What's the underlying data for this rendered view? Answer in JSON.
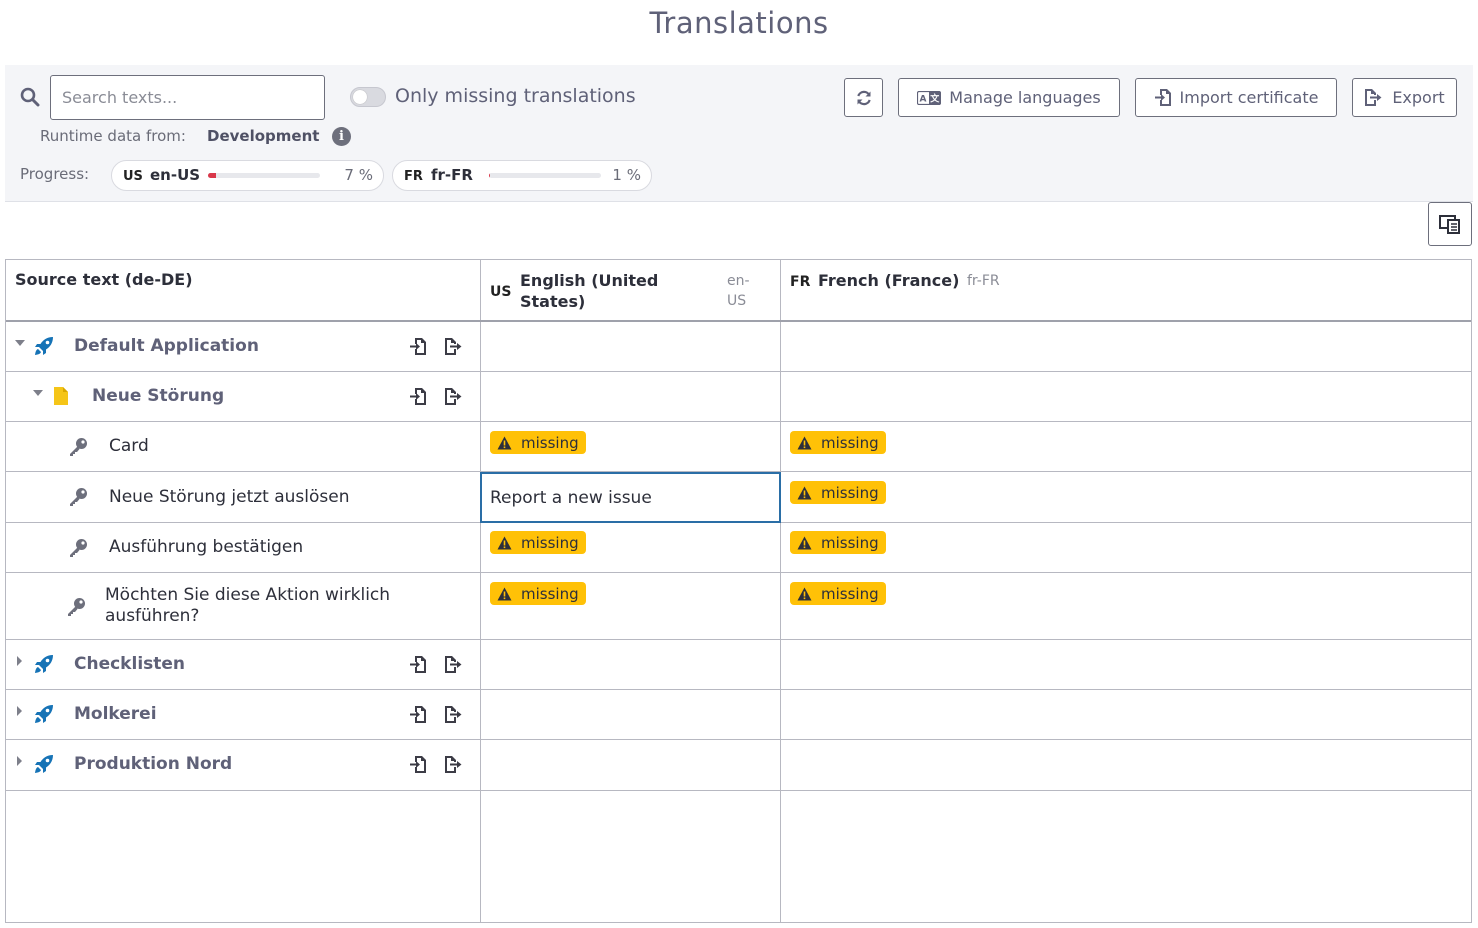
{
  "page_title": "Translations",
  "toolbar": {
    "search_placeholder": "Search texts...",
    "toggle_label": "Only missing translations",
    "refresh_icon": "refresh-icon",
    "manage_languages_label": "Manage languages",
    "import_certificate_label": "Import certificate",
    "export_label": "Export",
    "runtime_label": "Runtime data from:",
    "runtime_value": "Development",
    "progress_label": "Progress:"
  },
  "progress": [
    {
      "flag": "US",
      "code": "en-US",
      "percent_text": "7 %",
      "fraction": 0.07
    },
    {
      "flag": "FR",
      "code": "fr-FR",
      "percent_text": "1 %",
      "fraction": 0.01
    }
  ],
  "table": {
    "source_header": "Source text (de-DE)",
    "languages": [
      {
        "flag": "US",
        "name": "English (United States)",
        "code": "en-US"
      },
      {
        "flag": "FR",
        "name": "French (France)",
        "code": "fr-FR"
      }
    ],
    "missing_label": "missing",
    "rows": [
      {
        "type": "app",
        "label": "Default Application",
        "expanded": true
      },
      {
        "type": "page",
        "label": "Neue Störung",
        "expanded": true
      },
      {
        "type": "key",
        "label": "Card",
        "en": "missing",
        "fr": "missing"
      },
      {
        "type": "key",
        "label": "Neue Störung jetzt auslösen",
        "en": "Report a new issue",
        "fr": "missing"
      },
      {
        "type": "key",
        "label": "Ausführung bestätigen",
        "en": "missing",
        "fr": "missing"
      },
      {
        "type": "key",
        "label": "Möchten Sie diese Aktion wirklich ausführen?",
        "en": "missing",
        "fr": "missing"
      },
      {
        "type": "app",
        "label": "Checklisten",
        "expanded": false
      },
      {
        "type": "app",
        "label": "Molkerei",
        "expanded": false
      },
      {
        "type": "app",
        "label": "Produktion Nord",
        "expanded": false
      }
    ]
  },
  "colors": {
    "accent": "#1673b6",
    "missing_badge": "#ffc107",
    "progress_fill": "#d9384a",
    "page_icon": "#f5c518"
  }
}
